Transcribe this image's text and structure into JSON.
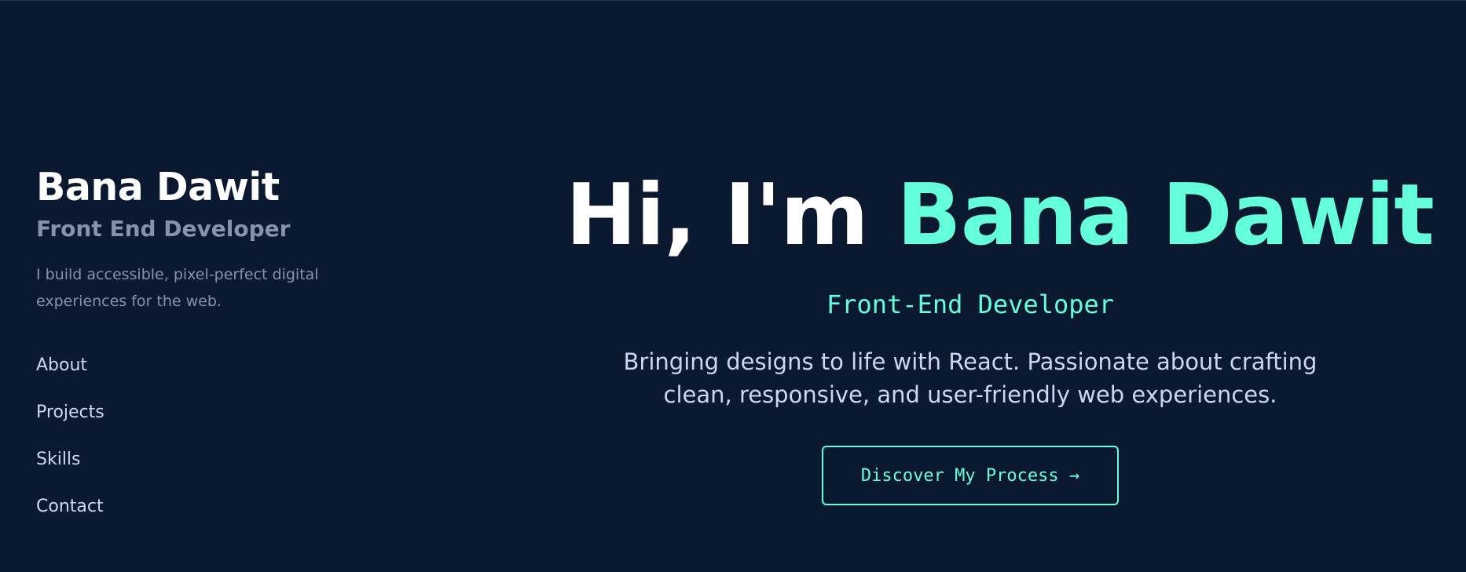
{
  "sidebar": {
    "name": "Bana Dawit",
    "role": "Front End Developer",
    "bio": "I build accessible, pixel-perfect digital experiences for the web.",
    "nav": [
      {
        "label": "About"
      },
      {
        "label": "Projects"
      },
      {
        "label": "Skills"
      },
      {
        "label": "Contact"
      }
    ]
  },
  "hero": {
    "greeting": "Hi, I'm ",
    "name": "Bana Dawit",
    "subtitle": "Front-End Developer",
    "description": "Bringing designs to life with React. Passionate about crafting clean, responsive, and user-friendly web experiences.",
    "cta_label": "Discover My Process →"
  },
  "colors": {
    "background": "#0a192f",
    "accent": "#64ffda",
    "text_primary": "#ffffff",
    "text_light": "#ccd6f6",
    "text_muted": "#8892b0"
  }
}
